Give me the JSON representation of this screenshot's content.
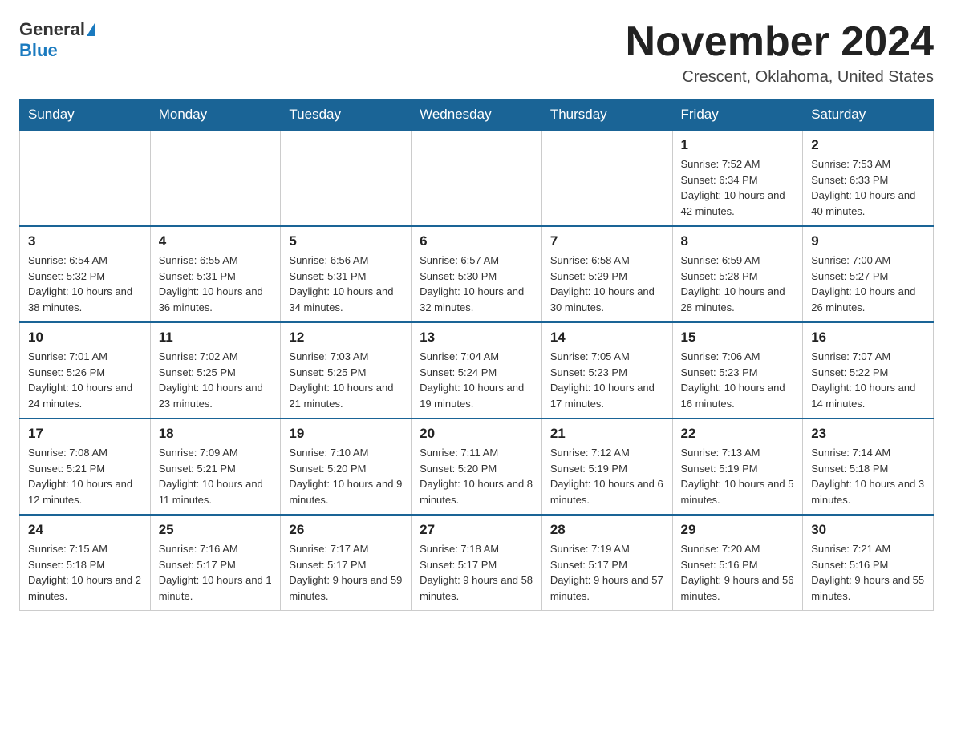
{
  "header": {
    "logo_general": "General",
    "logo_blue": "Blue",
    "month_title": "November 2024",
    "location": "Crescent, Oklahoma, United States"
  },
  "weekdays": [
    "Sunday",
    "Monday",
    "Tuesday",
    "Wednesday",
    "Thursday",
    "Friday",
    "Saturday"
  ],
  "weeks": [
    [
      {
        "day": "",
        "sunrise": "",
        "sunset": "",
        "daylight": "",
        "empty": true
      },
      {
        "day": "",
        "sunrise": "",
        "sunset": "",
        "daylight": "",
        "empty": true
      },
      {
        "day": "",
        "sunrise": "",
        "sunset": "",
        "daylight": "",
        "empty": true
      },
      {
        "day": "",
        "sunrise": "",
        "sunset": "",
        "daylight": "",
        "empty": true
      },
      {
        "day": "",
        "sunrise": "",
        "sunset": "",
        "daylight": "",
        "empty": true
      },
      {
        "day": "1",
        "sunrise": "Sunrise: 7:52 AM",
        "sunset": "Sunset: 6:34 PM",
        "daylight": "Daylight: 10 hours and 42 minutes.",
        "empty": false
      },
      {
        "day": "2",
        "sunrise": "Sunrise: 7:53 AM",
        "sunset": "Sunset: 6:33 PM",
        "daylight": "Daylight: 10 hours and 40 minutes.",
        "empty": false
      }
    ],
    [
      {
        "day": "3",
        "sunrise": "Sunrise: 6:54 AM",
        "sunset": "Sunset: 5:32 PM",
        "daylight": "Daylight: 10 hours and 38 minutes.",
        "empty": false
      },
      {
        "day": "4",
        "sunrise": "Sunrise: 6:55 AM",
        "sunset": "Sunset: 5:31 PM",
        "daylight": "Daylight: 10 hours and 36 minutes.",
        "empty": false
      },
      {
        "day": "5",
        "sunrise": "Sunrise: 6:56 AM",
        "sunset": "Sunset: 5:31 PM",
        "daylight": "Daylight: 10 hours and 34 minutes.",
        "empty": false
      },
      {
        "day": "6",
        "sunrise": "Sunrise: 6:57 AM",
        "sunset": "Sunset: 5:30 PM",
        "daylight": "Daylight: 10 hours and 32 minutes.",
        "empty": false
      },
      {
        "day": "7",
        "sunrise": "Sunrise: 6:58 AM",
        "sunset": "Sunset: 5:29 PM",
        "daylight": "Daylight: 10 hours and 30 minutes.",
        "empty": false
      },
      {
        "day": "8",
        "sunrise": "Sunrise: 6:59 AM",
        "sunset": "Sunset: 5:28 PM",
        "daylight": "Daylight: 10 hours and 28 minutes.",
        "empty": false
      },
      {
        "day": "9",
        "sunrise": "Sunrise: 7:00 AM",
        "sunset": "Sunset: 5:27 PM",
        "daylight": "Daylight: 10 hours and 26 minutes.",
        "empty": false
      }
    ],
    [
      {
        "day": "10",
        "sunrise": "Sunrise: 7:01 AM",
        "sunset": "Sunset: 5:26 PM",
        "daylight": "Daylight: 10 hours and 24 minutes.",
        "empty": false
      },
      {
        "day": "11",
        "sunrise": "Sunrise: 7:02 AM",
        "sunset": "Sunset: 5:25 PM",
        "daylight": "Daylight: 10 hours and 23 minutes.",
        "empty": false
      },
      {
        "day": "12",
        "sunrise": "Sunrise: 7:03 AM",
        "sunset": "Sunset: 5:25 PM",
        "daylight": "Daylight: 10 hours and 21 minutes.",
        "empty": false
      },
      {
        "day": "13",
        "sunrise": "Sunrise: 7:04 AM",
        "sunset": "Sunset: 5:24 PM",
        "daylight": "Daylight: 10 hours and 19 minutes.",
        "empty": false
      },
      {
        "day": "14",
        "sunrise": "Sunrise: 7:05 AM",
        "sunset": "Sunset: 5:23 PM",
        "daylight": "Daylight: 10 hours and 17 minutes.",
        "empty": false
      },
      {
        "day": "15",
        "sunrise": "Sunrise: 7:06 AM",
        "sunset": "Sunset: 5:23 PM",
        "daylight": "Daylight: 10 hours and 16 minutes.",
        "empty": false
      },
      {
        "day": "16",
        "sunrise": "Sunrise: 7:07 AM",
        "sunset": "Sunset: 5:22 PM",
        "daylight": "Daylight: 10 hours and 14 minutes.",
        "empty": false
      }
    ],
    [
      {
        "day": "17",
        "sunrise": "Sunrise: 7:08 AM",
        "sunset": "Sunset: 5:21 PM",
        "daylight": "Daylight: 10 hours and 12 minutes.",
        "empty": false
      },
      {
        "day": "18",
        "sunrise": "Sunrise: 7:09 AM",
        "sunset": "Sunset: 5:21 PM",
        "daylight": "Daylight: 10 hours and 11 minutes.",
        "empty": false
      },
      {
        "day": "19",
        "sunrise": "Sunrise: 7:10 AM",
        "sunset": "Sunset: 5:20 PM",
        "daylight": "Daylight: 10 hours and 9 minutes.",
        "empty": false
      },
      {
        "day": "20",
        "sunrise": "Sunrise: 7:11 AM",
        "sunset": "Sunset: 5:20 PM",
        "daylight": "Daylight: 10 hours and 8 minutes.",
        "empty": false
      },
      {
        "day": "21",
        "sunrise": "Sunrise: 7:12 AM",
        "sunset": "Sunset: 5:19 PM",
        "daylight": "Daylight: 10 hours and 6 minutes.",
        "empty": false
      },
      {
        "day": "22",
        "sunrise": "Sunrise: 7:13 AM",
        "sunset": "Sunset: 5:19 PM",
        "daylight": "Daylight: 10 hours and 5 minutes.",
        "empty": false
      },
      {
        "day": "23",
        "sunrise": "Sunrise: 7:14 AM",
        "sunset": "Sunset: 5:18 PM",
        "daylight": "Daylight: 10 hours and 3 minutes.",
        "empty": false
      }
    ],
    [
      {
        "day": "24",
        "sunrise": "Sunrise: 7:15 AM",
        "sunset": "Sunset: 5:18 PM",
        "daylight": "Daylight: 10 hours and 2 minutes.",
        "empty": false
      },
      {
        "day": "25",
        "sunrise": "Sunrise: 7:16 AM",
        "sunset": "Sunset: 5:17 PM",
        "daylight": "Daylight: 10 hours and 1 minute.",
        "empty": false
      },
      {
        "day": "26",
        "sunrise": "Sunrise: 7:17 AM",
        "sunset": "Sunset: 5:17 PM",
        "daylight": "Daylight: 9 hours and 59 minutes.",
        "empty": false
      },
      {
        "day": "27",
        "sunrise": "Sunrise: 7:18 AM",
        "sunset": "Sunset: 5:17 PM",
        "daylight": "Daylight: 9 hours and 58 minutes.",
        "empty": false
      },
      {
        "day": "28",
        "sunrise": "Sunrise: 7:19 AM",
        "sunset": "Sunset: 5:17 PM",
        "daylight": "Daylight: 9 hours and 57 minutes.",
        "empty": false
      },
      {
        "day": "29",
        "sunrise": "Sunrise: 7:20 AM",
        "sunset": "Sunset: 5:16 PM",
        "daylight": "Daylight: 9 hours and 56 minutes.",
        "empty": false
      },
      {
        "day": "30",
        "sunrise": "Sunrise: 7:21 AM",
        "sunset": "Sunset: 5:16 PM",
        "daylight": "Daylight: 9 hours and 55 minutes.",
        "empty": false
      }
    ]
  ]
}
